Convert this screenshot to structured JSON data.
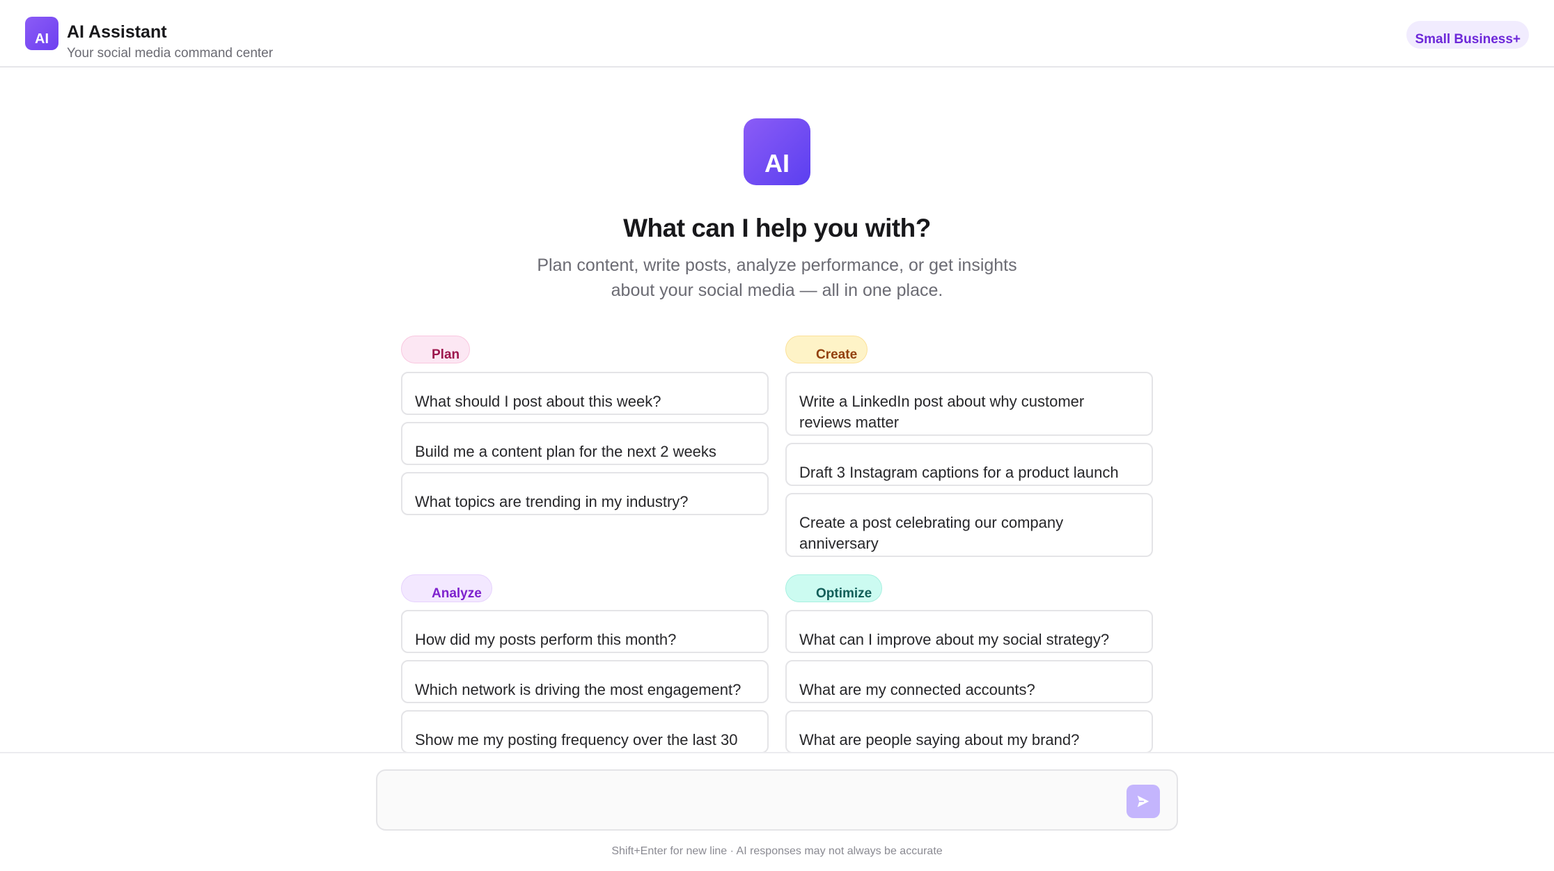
{
  "header": {
    "logo_text": "AI",
    "title": "AI Assistant",
    "subtitle": "Your social media command center",
    "plan_badge": "Small Business+"
  },
  "hero": {
    "logo_text": "AI",
    "title": "What can I help you with?",
    "subtitle": "Plan content, write posts, analyze performance, or get insights about your social media — all in one place."
  },
  "sections": {
    "plan": {
      "label": "Plan",
      "prompts": [
        "What should I post about this week?",
        "Build me a content plan for the next 2 weeks",
        "What topics are trending in my industry?"
      ]
    },
    "create": {
      "label": "Create",
      "prompts": [
        "Write a LinkedIn post about why customer reviews matter",
        "Draft 3 Instagram captions for a product launch",
        "Create a post celebrating our company anniversary"
      ]
    },
    "analyze": {
      "label": "Analyze",
      "prompts": [
        "How did my posts perform this month?",
        "Which network is driving the most engagement?",
        "Show me my posting frequency over the last 30"
      ]
    },
    "optimize": {
      "label": "Optimize",
      "prompts": [
        "What can I improve about my social strategy?",
        "What are my connected accounts?",
        "What are people saying about my brand?"
      ]
    }
  },
  "composer": {
    "value": "",
    "hint": "Shift+Enter for new line · AI responses may not always be accurate",
    "send_icon": "send-arrow-icon"
  },
  "colors": {
    "accent": "#7c3aed",
    "plan": "#fce7f3",
    "create": "#fef3c7",
    "analyze": "#f3e8ff",
    "optimize": "#ccfbf1"
  }
}
